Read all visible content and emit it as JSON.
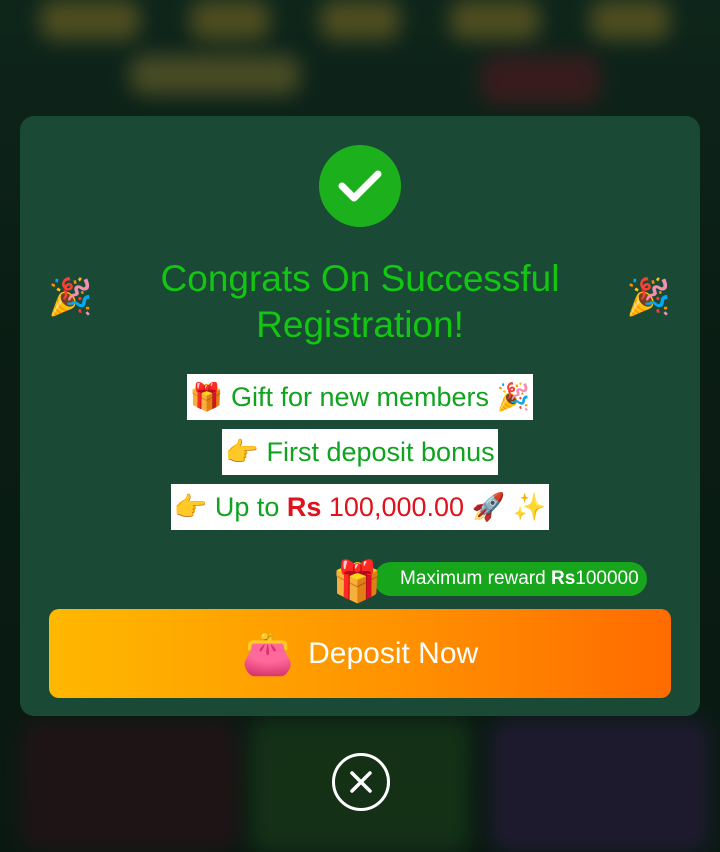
{
  "modal": {
    "title": "Congrats On Successful Registration!",
    "confetti_left": "🎉",
    "confetti_right": "🎉",
    "lines": [
      {
        "text": "🎁 Gift for new members 🎉"
      },
      {
        "text": "👉 First deposit bonus"
      },
      {
        "prefix": "👉 Up to ",
        "currency": "Rs",
        "amount": " 100,000.00",
        "suffix": " 🚀 ✨"
      }
    ],
    "reward": {
      "icon": "🎁",
      "label": "Maximum reward ",
      "currency": "Rs",
      "amount": "100000"
    },
    "deposit_button": {
      "icon": "👛",
      "label": "Deposit Now"
    },
    "close_icon": "close-circle-icon"
  },
  "colors": {
    "modal_bg": "#1a4a36",
    "title": "#12c612",
    "success_check": "#1cb11c",
    "reward_badge": "#17a51c",
    "deposit_gradient_start": "#ffb800",
    "deposit_gradient_end": "#ff6b00",
    "currency": "#e0121c"
  }
}
